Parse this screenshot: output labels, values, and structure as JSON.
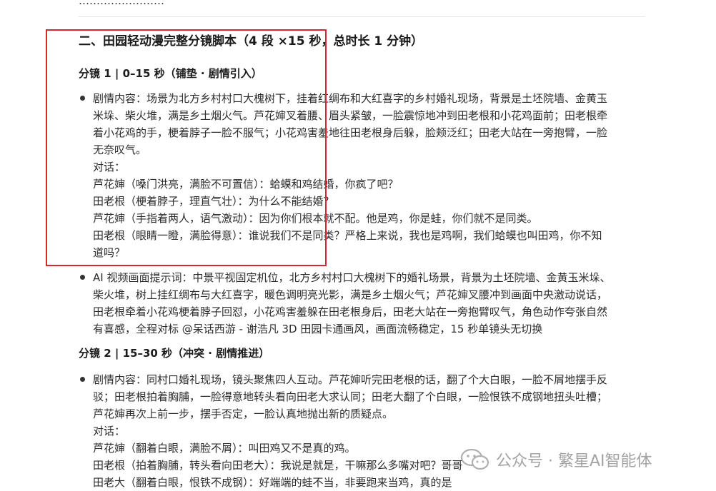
{
  "document": {
    "top_partial_text": "……………………",
    "section_title": "二、田园轻动漫完整分镜脚本（4 段 ×15 秒，总时长 1 分钟）",
    "shot1": {
      "heading": "分镜 1 | 0–15 秒（铺垫 · 剧情引入）",
      "content_lines": [
        "剧情内容：场景为北方乡村村口大槐树下，挂着红绸布和大红喜字的乡村婚礼现场，背景是土坯院墙、金黄玉",
        "米垛、柴火堆，满是乡土烟火气。芦花婶叉着腰、眉头紧皱，一脸震惊地冲到田老根和小花鸡面前；田老根牵",
        "着小花鸡的手，梗着脖子一脸不服气；小花鸡害羞地往田老根身后躲，脸颊泛红；田老大站在一旁抱臂，一脸",
        "无奈叹气。"
      ],
      "dialogue_label": "对话：",
      "dialogue_lines": [
        "芦花婶（嗓门洪亮，满脸不可置信）：蛤蟆和鸡结婚，你疯了吧？",
        "田老根（梗着脖子，理直气壮）：为什么不能结婚？",
        "芦花婶（手指着两人，语气激动）：因为你们根本就不配。他是鸡，你是蛙，你们就不是同类。",
        "田老根（眼睛一瞪，满脸得意）：谁说我们不是同类？严格上来说，我也是鸡啊，我们蛤蟆也叫田鸡，你不知",
        "道吗？"
      ],
      "prompt_lines": [
        "AI 视频画面提示词：中景平视固定机位，北方乡村村口大槐树下的婚礼场景，背景为土坯院墙、金黄玉米垛、",
        "柴火堆，树上挂红绸布与大红喜字，暖色调明亮光影，满是乡土烟火气；芦花婶叉腰冲到画面中央激动说话，",
        "田老根牵着小花鸡梗着脖子回怼，小花鸡害羞躲在田老根身后，田老大站在一旁抱臂叹气，角色动作夸张自然",
        "有喜感，全程对标 @呆话西游 - 谢浩凡 3D 田园卡通画风，画面流畅稳定，15 秒单镜头无切换"
      ]
    },
    "shot2": {
      "heading": "分镜 2 | 15–30 秒（冲突 · 剧情推进）",
      "content_lines": [
        "剧情内容：同村口婚礼现场，镜头聚焦四人互动。芦花婶听完田老根的话，翻了个大白眼，一脸不屑地摆手反",
        "驳；田老根拍着胸脯，一脸得意地转头看向田老大求认同；田老大翻了个白眼，一脸恨铁不成钢地扭头吐槽；",
        "芦花婶再次上前一步，摆手否定，一脸认真地抛出新的质疑点。"
      ],
      "dialogue_label": "对话：",
      "dialogue_lines": [
        "芦花婶（翻着白眼，满脸不屑）：叫田鸡又不是真的鸡。",
        "田老根（拍着胸脯，转头看向田老大）：我说是就是，干嘛那么多嘴对吧？哥哥",
        "田老大（翻着白眼，恨铁不成钢）：好端端的蛙不当，非要跑来当鸡，真的是"
      ]
    }
  },
  "watermark": {
    "text": "公众号 · 繁星AI智能体",
    "icon": "wechat-icon"
  },
  "colors": {
    "highlight_box": "#d9262c",
    "text": "#2b2b2b",
    "watermark": "#9a9a9a"
  }
}
